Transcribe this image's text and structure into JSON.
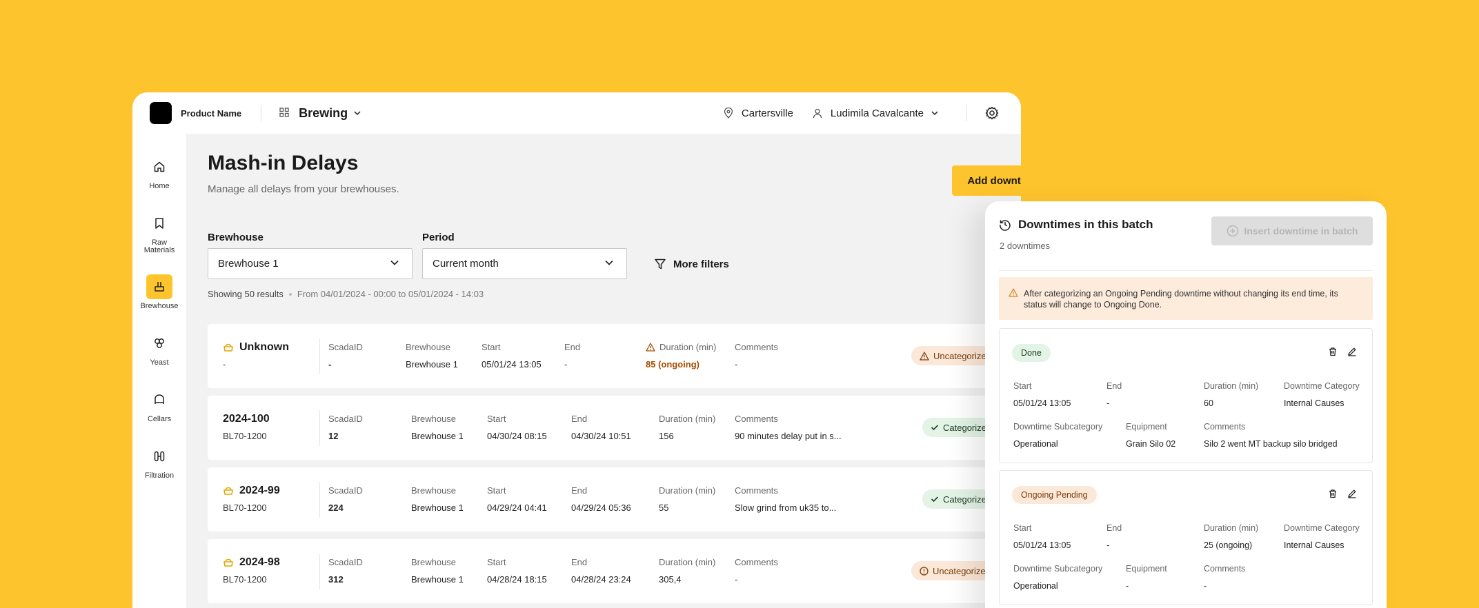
{
  "header": {
    "product_name": "Product Name",
    "module": "Brewing",
    "location": "Cartersville",
    "user": "Ludimila Cavalcante"
  },
  "sidebar": {
    "items": [
      {
        "label": "Home",
        "icon": "home-icon"
      },
      {
        "label": "Raw Materials",
        "icon": "bookmark-icon"
      },
      {
        "label": "Brewhouse",
        "icon": "brewhouse-icon",
        "active": true
      },
      {
        "label": "Yeast",
        "icon": "yeast-icon"
      },
      {
        "label": "Cellars",
        "icon": "cellar-icon"
      },
      {
        "label": "Filtration",
        "icon": "filtration-icon"
      }
    ]
  },
  "page": {
    "title": "Mash-in Delays",
    "subtitle": "Manage all delays from your brewhouses.",
    "add_button": "Add downtime"
  },
  "filters": {
    "brewhouse_label": "Brewhouse",
    "brewhouse_value": "Brewhouse 1",
    "period_label": "Period",
    "period_value": "Current month",
    "more_filters": "More filters",
    "results": "Showing 50 results",
    "range": "From 04/01/2024 - 00:00 to 05/01/2024 - 14:03"
  },
  "columns": {
    "scada": "ScadaID",
    "brewhouse": "Brewhouse",
    "start": "Start",
    "end": "End",
    "duration": "Duration (min)",
    "comments": "Comments"
  },
  "rows": [
    {
      "id": "Unknown",
      "sub": "-",
      "scada": "-",
      "brewhouse": "Brewhouse 1",
      "start": "05/01/24 13:05",
      "end": "-",
      "duration": "85 (ongoing)",
      "comments": "-",
      "status": "Uncategorized"
    },
    {
      "id": "2024-100",
      "sub": "BL70-1200",
      "scada": "12",
      "brewhouse": "Brewhouse 1",
      "start": "04/30/24 08:15",
      "end": "04/30/24 10:51",
      "duration": "156",
      "comments": "90 minutes delay put in s...",
      "status": "Categorized"
    },
    {
      "id": "2024-99",
      "sub": "BL70-1200",
      "scada": "224",
      "brewhouse": "Brewhouse 1",
      "start": "04/29/24 04:41",
      "end": "04/29/24 05:36",
      "duration": "55",
      "comments": "Slow grind from uk35 to...",
      "status": "Categorized"
    },
    {
      "id": "2024-98",
      "sub": "BL70-1200",
      "scada": "312",
      "brewhouse": "Brewhouse 1",
      "start": "04/28/24 18:15",
      "end": "04/28/24 23:24",
      "duration": "305,4",
      "comments": "-",
      "status": "Uncategorized"
    }
  ],
  "panel": {
    "title": "Downtimes in this batch",
    "subtitle": "2 downtimes",
    "insert_button": "Insert downtime in batch",
    "alert": "After categorizing an Ongoing Pending downtime without changing its end time, its status will change to Ongoing Done.",
    "labels": {
      "start": "Start",
      "end": "End",
      "duration": "Duration (min)",
      "category": "Downtime Category",
      "subcategory": "Downtime Subcategory",
      "equipment": "Equipment",
      "comments": "Comments"
    },
    "downtimes": [
      {
        "status": "Done",
        "start": "05/01/24 13:05",
        "end": "-",
        "duration": "60",
        "category": "Internal Causes",
        "subcategory": "Operational",
        "equipment": "Grain Silo 02",
        "comments": "Silo 2 went MT backup silo bridged"
      },
      {
        "status": "Ongoing Pending",
        "start": "05/01/24 13:05",
        "end": "-",
        "duration": "25 (ongoing)",
        "category": "Internal Causes",
        "subcategory": "Operational",
        "equipment": "-",
        "comments": "-"
      }
    ]
  },
  "colors": {
    "background": "#FEC42D",
    "accent": "#FEC42D",
    "warn_badge": "#FCE8D8",
    "ok_badge": "#E3F3E6",
    "ongoing_text": "#A84C00"
  }
}
